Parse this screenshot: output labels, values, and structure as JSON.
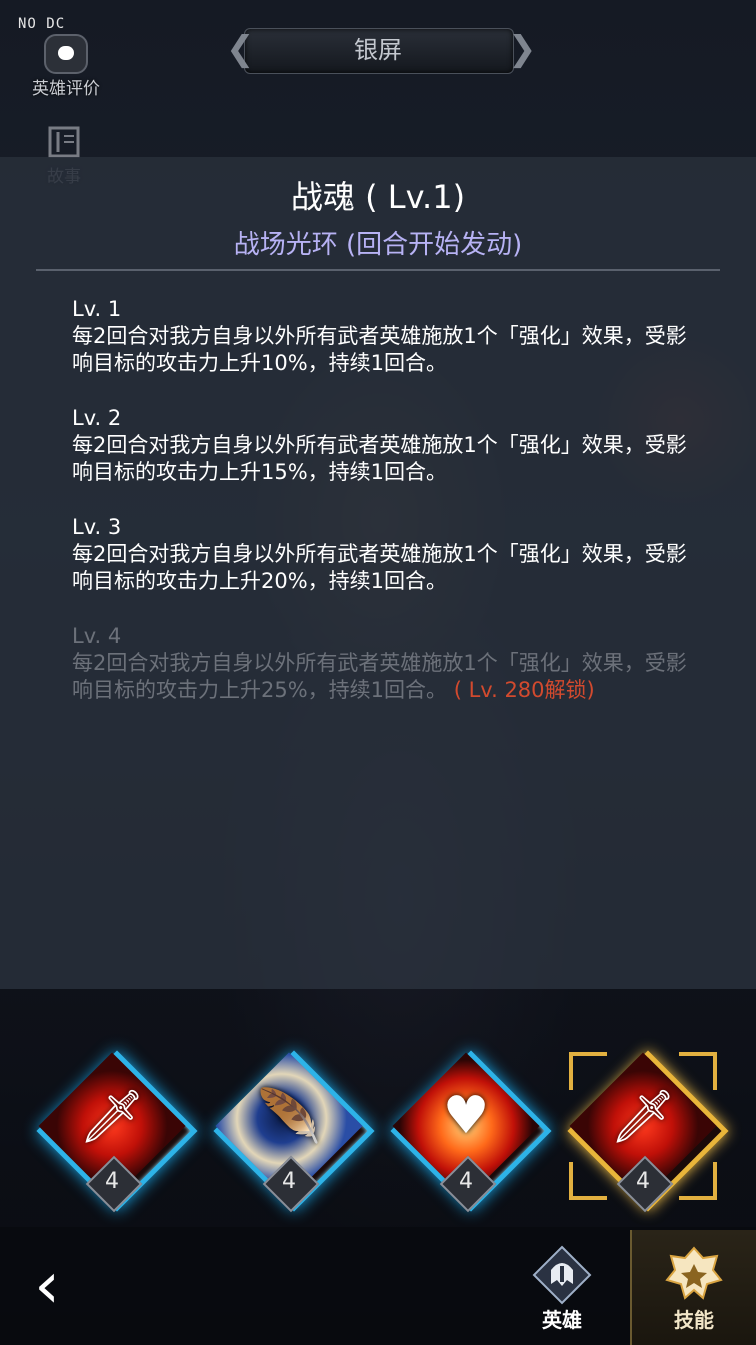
{
  "debug_label": "NO DC",
  "top_nav": {
    "title": "银屏",
    "prev_arrow": "❮",
    "next_arrow": "❯"
  },
  "side_buttons": {
    "review_label": "英雄评价",
    "story_label": "故事"
  },
  "skill_panel": {
    "title": "战魂 ( Lv.1)",
    "subtitle": "战场光环 (回合开始发动)",
    "levels": [
      {
        "head": "Lv. 1",
        "text": "每2回合对我方自身以外所有武者英雄施放1个「强化」效果，受影响目标的攻击力上升10%，持续1回合。"
      },
      {
        "head": "Lv. 2",
        "text": "每2回合对我方自身以外所有武者英雄施放1个「强化」效果，受影响目标的攻击力上升15%，持续1回合。"
      },
      {
        "head": "Lv. 3",
        "text": "每2回合对我方自身以外所有武者英雄施放1个「强化」效果，受影响目标的攻击力上升20%，持续1回合。"
      },
      {
        "head": "Lv. 4",
        "text": "每2回合对我方自身以外所有武者英雄施放1个「强化」效果，受影响目标的攻击力上升25%，持续1回合。",
        "unlock": " ( Lv. 280解锁)"
      }
    ]
  },
  "skills": [
    {
      "icon": "flaming-sword-icon",
      "glyph": "🗡",
      "level": "4"
    },
    {
      "icon": "swirl-feather-icon",
      "glyph": "🪶",
      "level": "4"
    },
    {
      "icon": "glowing-heart-icon",
      "glyph": "♥",
      "level": "4"
    },
    {
      "icon": "flaming-sword-icon",
      "glyph": "🗡",
      "level": "4"
    }
  ],
  "bottom_nav": {
    "back_glyph": "‹",
    "hero_label": "英雄",
    "skill_label": "技能"
  },
  "colors": {
    "accent_cyan": "#2db3e8",
    "accent_gold": "#e9b53a",
    "subtitle": "#b7b2f4",
    "unlock_red": "#d24a2e"
  }
}
